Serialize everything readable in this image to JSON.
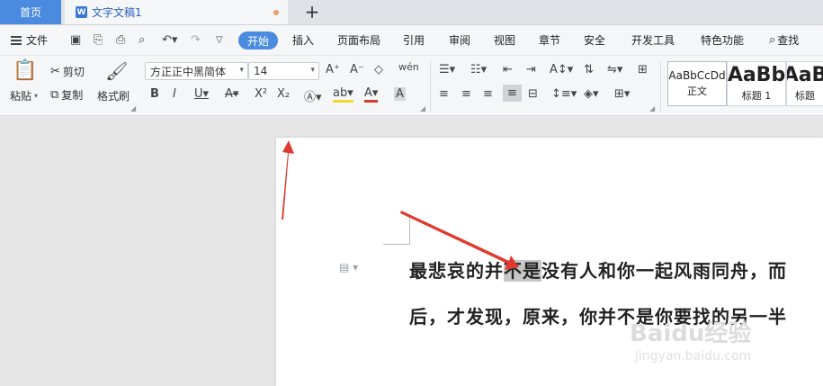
{
  "tabs": {
    "home": "首页",
    "document": "文字文稿1",
    "add": "+",
    "doc_icon_letter": "W"
  },
  "menu": {
    "file": "文件",
    "items": [
      "开始",
      "插入",
      "页面布局",
      "引用",
      "审阅",
      "视图",
      "章节",
      "安全",
      "开发工具",
      "特色功能"
    ],
    "search": "查找"
  },
  "ribbon": {
    "paste": "粘贴",
    "cut": "剪切",
    "copy": "复制",
    "format_painter": "格式刷",
    "font_name": "方正正中黑简体",
    "font_size": "14",
    "styles": [
      {
        "sample": "AaBbCcDd",
        "label": "正文"
      },
      {
        "sample": "AaBb",
        "label": "标题 1"
      },
      {
        "sample": "AaB",
        "label": "标题"
      }
    ]
  },
  "document": {
    "line1_before": "最悲哀的并",
    "line1_selected": "不是",
    "line1_after": "没有人和你一起风雨同舟，而",
    "line2": "后，才发现，原来，你并不是你要找的另一半"
  },
  "watermark": {
    "main": "Baidu经验",
    "sub": "jingyan.baidu.com"
  },
  "colors": {
    "accent": "#4a8be0",
    "arrow": "#e03a2e",
    "selection": "#c6c6c6"
  }
}
